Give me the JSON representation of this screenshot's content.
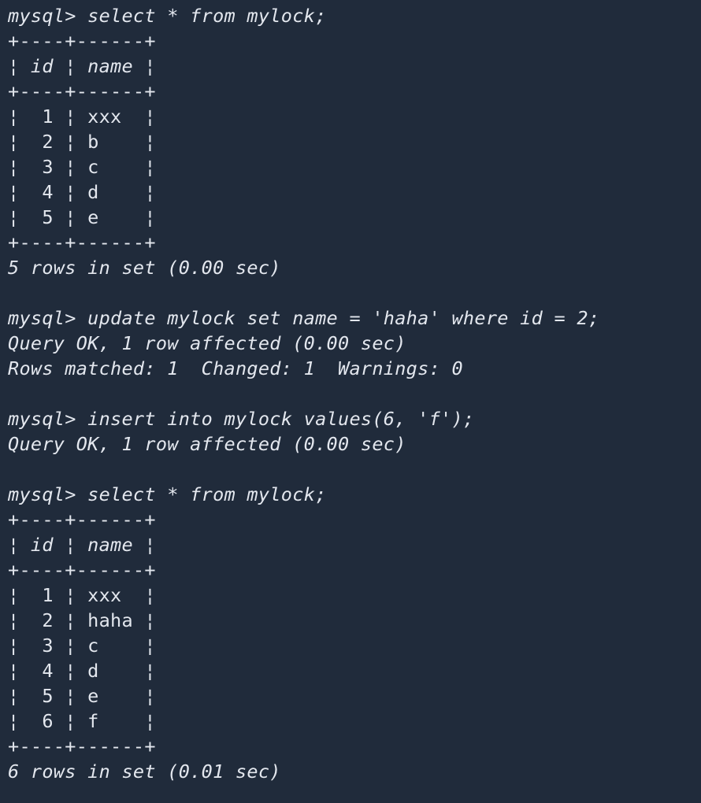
{
  "window": {
    "bg": "#202b3b",
    "fg": "#e3e7ee"
  },
  "lines": [
    {
      "text": "mysql> select * from mylock;",
      "style": "italic"
    },
    {
      "text": "+----+------+",
      "style": "upright"
    },
    {
      "text": "¦ id ¦ name ¦",
      "style": "italic"
    },
    {
      "text": "+----+------+",
      "style": "upright"
    },
    {
      "text": "¦  1 ¦ xxx  ¦",
      "style": "upright"
    },
    {
      "text": "¦  2 ¦ b    ¦",
      "style": "upright"
    },
    {
      "text": "¦  3 ¦ c    ¦",
      "style": "upright"
    },
    {
      "text": "¦  4 ¦ d    ¦",
      "style": "upright"
    },
    {
      "text": "¦  5 ¦ e    ¦",
      "style": "upright"
    },
    {
      "text": "+----+------+",
      "style": "upright"
    },
    {
      "text": "5 rows in set (0.00 sec)",
      "style": "italic"
    },
    {
      "text": "",
      "style": "upright"
    },
    {
      "text": "mysql> update mylock set name = 'haha' where id = 2;",
      "style": "italic"
    },
    {
      "text": "Query OK, 1 row affected (0.00 sec)",
      "style": "italic"
    },
    {
      "text": "Rows matched: 1  Changed: 1  Warnings: 0",
      "style": "italic"
    },
    {
      "text": "",
      "style": "upright"
    },
    {
      "text": "mysql> insert into mylock values(6, 'f');",
      "style": "italic"
    },
    {
      "text": "Query OK, 1 row affected (0.00 sec)",
      "style": "italic"
    },
    {
      "text": "",
      "style": "upright"
    },
    {
      "text": "mysql> select * from mylock;",
      "style": "italic"
    },
    {
      "text": "+----+------+",
      "style": "upright"
    },
    {
      "text": "¦ id ¦ name ¦",
      "style": "italic"
    },
    {
      "text": "+----+------+",
      "style": "upright"
    },
    {
      "text": "¦  1 ¦ xxx  ¦",
      "style": "upright"
    },
    {
      "text": "¦  2 ¦ haha ¦",
      "style": "upright"
    },
    {
      "text": "¦  3 ¦ c    ¦",
      "style": "upright"
    },
    {
      "text": "¦  4 ¦ d    ¦",
      "style": "upright"
    },
    {
      "text": "¦  5 ¦ e    ¦",
      "style": "upright"
    },
    {
      "text": "¦  6 ¦ f    ¦",
      "style": "upright"
    },
    {
      "text": "+----+------+",
      "style": "upright"
    },
    {
      "text": "6 rows in set (0.01 sec)",
      "style": "italic"
    }
  ]
}
